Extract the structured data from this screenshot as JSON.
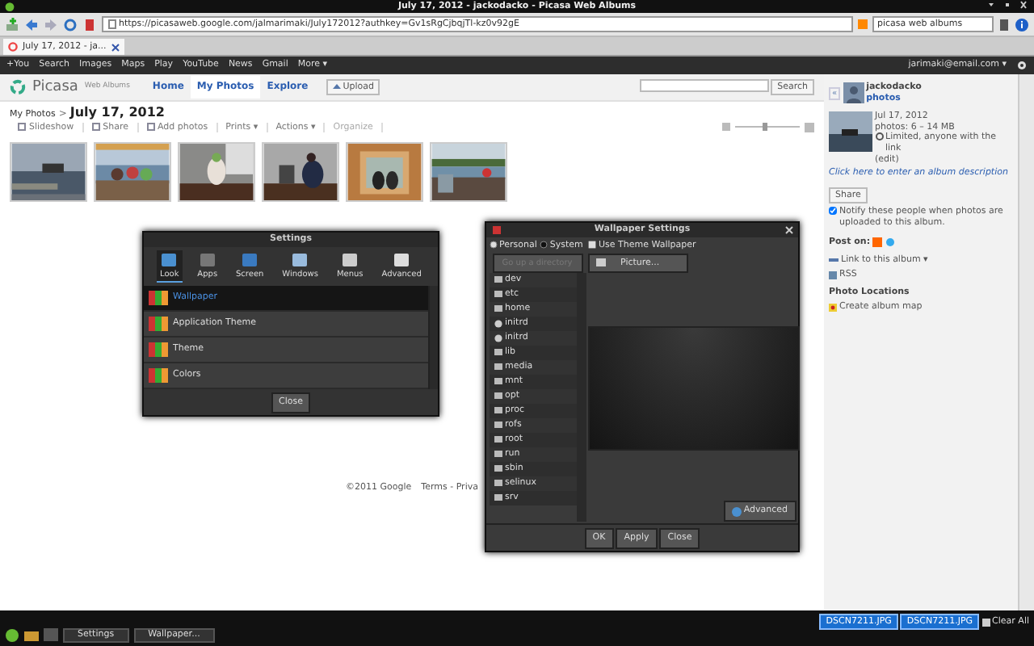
{
  "window": {
    "title": "July 17, 2012 - jackodacko - Picasa Web Albums"
  },
  "browser": {
    "url": "https://picasaweb.google.com/jalmarimaki/July172012?authkey=Gv1sRgCjbqjTl-kz0v92gE",
    "search": "picasa web albums",
    "tabs": [
      {
        "label": "July 17, 2012 - ja..."
      }
    ]
  },
  "google_bar": {
    "links": [
      "+You",
      "Search",
      "Images",
      "Maps",
      "Play",
      "YouTube",
      "News",
      "Gmail",
      "More ▾"
    ],
    "account": "jarimaki@email.com ▾"
  },
  "header": {
    "logo": "Picasa",
    "logo_sub": "Web Albums",
    "tabs": [
      {
        "label": "Home",
        "selected": false
      },
      {
        "label": "My Photos",
        "selected": true
      },
      {
        "label": "Explore",
        "selected": false
      }
    ],
    "upload": "Upload",
    "search_button": "Search"
  },
  "breadcrumb": {
    "parent": "My Photos",
    "separator": ">",
    "title": "July 17, 2012"
  },
  "toolbar": [
    {
      "label": "Slideshow",
      "kind": "icon",
      "disabled": false
    },
    {
      "label": "Share",
      "kind": "icon",
      "disabled": false
    },
    {
      "label": "Add photos",
      "kind": "icon",
      "disabled": false
    },
    {
      "label": "Prints ▾",
      "kind": "text",
      "disabled": false
    },
    {
      "label": "Actions ▾",
      "kind": "text",
      "disabled": false
    },
    {
      "label": "Organize",
      "kind": "text",
      "disabled": true
    }
  ],
  "zoom": {
    "level": 0.45
  },
  "footer": {
    "copyright": "©2011 Google",
    "links": "Terms - Priva"
  },
  "sidebar": {
    "collapse": "«",
    "user": "jackodacko",
    "user_link": "photos",
    "date": "Jul 17, 2012",
    "size": "photos: 6 – 14 MB",
    "visibility": "Limited, anyone with the link",
    "edit": "(edit)",
    "description": "Click here to enter an album description",
    "share": "Share",
    "notify": {
      "label": "Notify these people when photos are uploaded to this album.",
      "checked": true
    },
    "post_on": "Post on:",
    "link": "Link to this album ▾",
    "rss": "RSS",
    "locations_title": "Photo Locations",
    "map": "Create album map"
  },
  "settings_dialog": {
    "title": "Settings",
    "tabs": [
      {
        "label": "Look",
        "selected": true
      },
      {
        "label": "Apps",
        "selected": false
      },
      {
        "label": "Screen",
        "selected": false
      },
      {
        "label": "Windows",
        "selected": false
      },
      {
        "label": "Menus",
        "selected": false
      },
      {
        "label": "Advanced",
        "selected": false
      }
    ],
    "items": [
      {
        "label": "Wallpaper",
        "selected": true
      },
      {
        "label": "Application Theme",
        "selected": false
      },
      {
        "label": "Theme",
        "selected": false
      },
      {
        "label": "Colors",
        "selected": false
      }
    ],
    "close": "Close"
  },
  "wallpaper_dialog": {
    "title": "Wallpaper Settings",
    "sources": [
      {
        "label": "Personal",
        "selected": true
      },
      {
        "label": "System",
        "selected": false
      }
    ],
    "use_theme": {
      "label": "Use Theme Wallpaper",
      "checked": true
    },
    "up": {
      "label": "Go up a directory",
      "disabled": true
    },
    "dirs": [
      {
        "name": "dev",
        "kind": "folder"
      },
      {
        "name": "etc",
        "kind": "folder"
      },
      {
        "name": "home",
        "kind": "folder"
      },
      {
        "name": "initrd",
        "kind": "link"
      },
      {
        "name": "initrd",
        "kind": "link"
      },
      {
        "name": "lib",
        "kind": "folder"
      },
      {
        "name": "media",
        "kind": "folder"
      },
      {
        "name": "mnt",
        "kind": "folder"
      },
      {
        "name": "opt",
        "kind": "folder"
      },
      {
        "name": "proc",
        "kind": "folder"
      },
      {
        "name": "rofs",
        "kind": "folder"
      },
      {
        "name": "root",
        "kind": "folder"
      },
      {
        "name": "run",
        "kind": "folder"
      },
      {
        "name": "sbin",
        "kind": "folder"
      },
      {
        "name": "selinux",
        "kind": "folder"
      },
      {
        "name": "srv",
        "kind": "folder"
      }
    ],
    "picture": "Picture...",
    "advanced": "Advanced",
    "buttons": [
      "OK",
      "Apply",
      "Close"
    ]
  },
  "taskbar": {
    "windows": [
      {
        "label": "Settings",
        "selected": false
      },
      {
        "label": "Wallpaper...",
        "selected": false
      }
    ],
    "notifications": [
      "DSCN7211.JPG",
      "DSCN7211.JPG"
    ],
    "clear": "Clear All"
  }
}
